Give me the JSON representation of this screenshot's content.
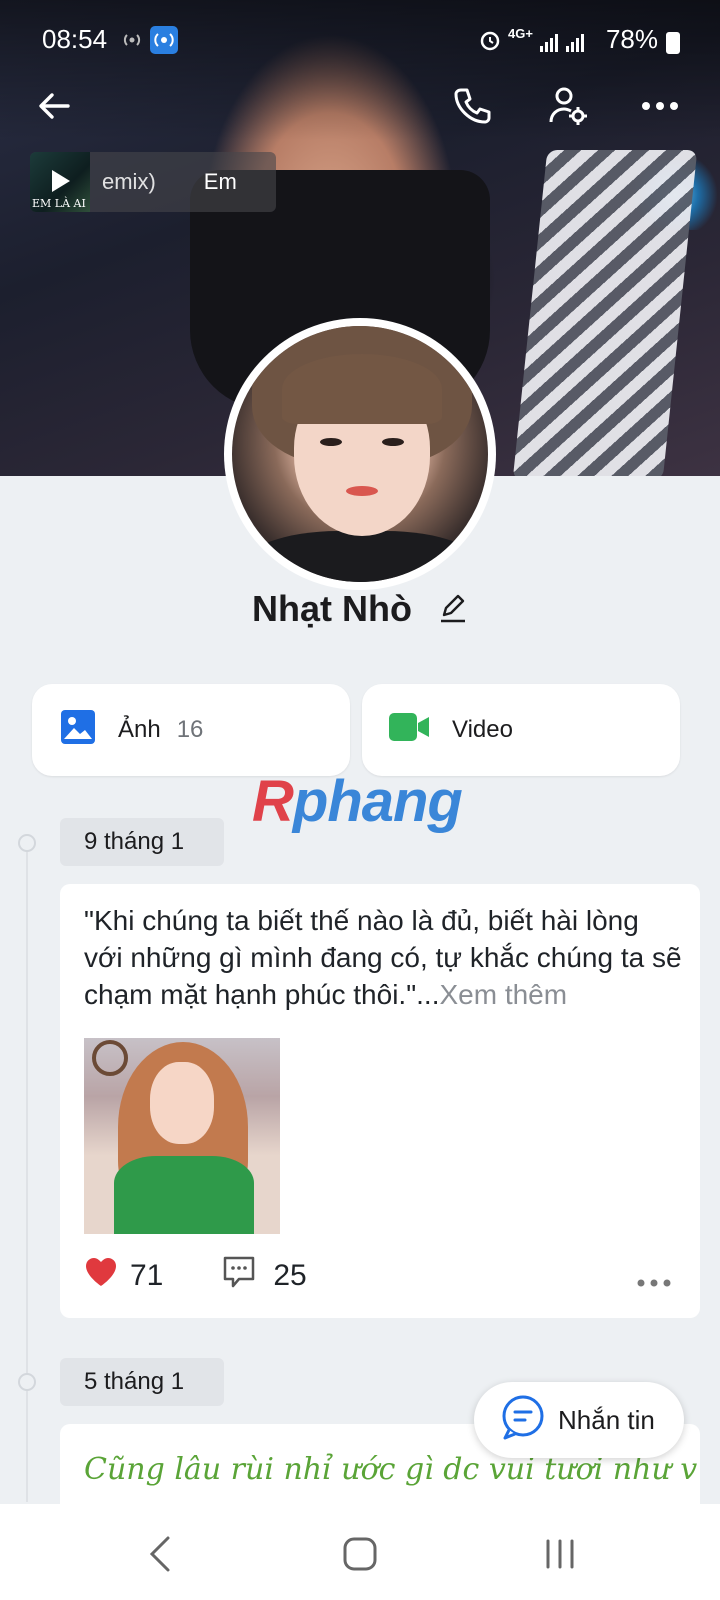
{
  "status_bar": {
    "time": "08:54",
    "network_label": "4G+",
    "battery_percent": "78%"
  },
  "header": {
    "back_icon": "arrow-left-icon",
    "call_icon": "phone-icon",
    "settings_icon": "user-settings-icon",
    "more_icon": "more-horizontal-icon"
  },
  "music": {
    "thumbnail_caption": "EM LÀ AI",
    "title_fragment": "emix)",
    "artist_fragment": "Em"
  },
  "profile": {
    "name": "Nhạt Nhò",
    "edit_icon": "pencil-icon"
  },
  "media": {
    "photos_label": "Ảnh",
    "photos_count": "16",
    "video_label": "Video"
  },
  "watermark": {
    "first_letter": "R",
    "rest": "phang"
  },
  "timeline": {
    "entries": [
      {
        "date": "9 tháng 1",
        "text": "\"Khi chúng ta biết thế nào là đủ, biết hài lòng với những gì mình đang có, tự khắc chúng ta sẽ chạm mặt hạnh phúc thôi.\"...",
        "more_label": "Xem thêm",
        "likes": "71",
        "comments": "25"
      },
      {
        "date": "5 tháng 1",
        "text": "Cũng lâu rùi nhỉ ước gì dc vui tươi như v mãi"
      }
    ]
  },
  "message_button": {
    "label": "Nhắn tin"
  },
  "colors": {
    "accent_blue": "#1f6fe5",
    "video_green": "#32b45a",
    "heart_red": "#e0393e",
    "post_green_text": "#5aa437"
  }
}
